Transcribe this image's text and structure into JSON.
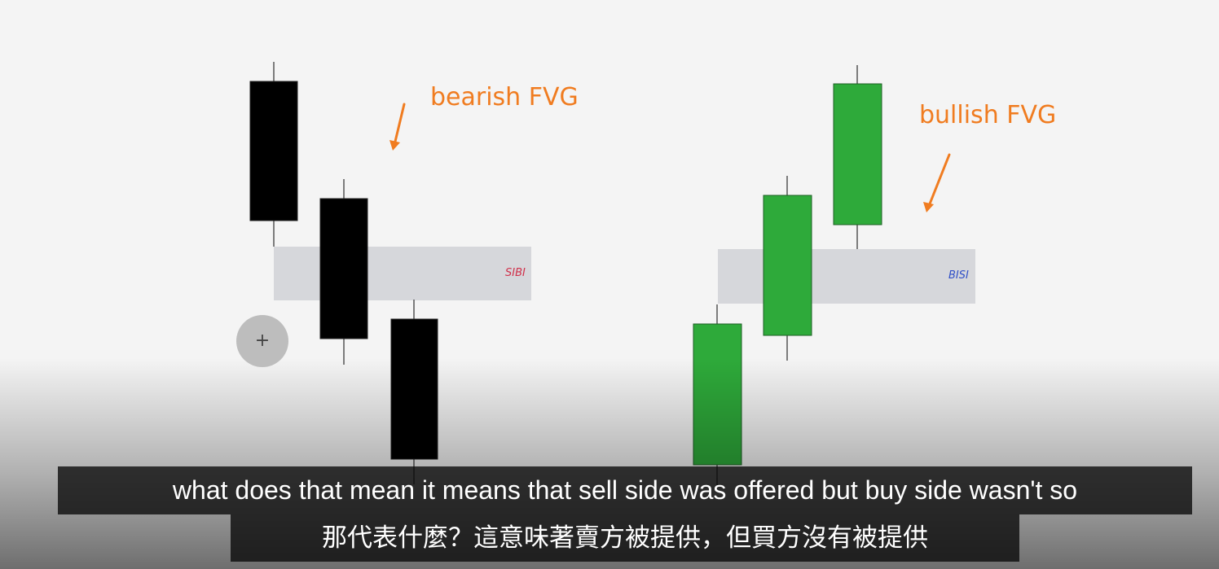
{
  "annotations": {
    "bearish": "bearish FVG",
    "bullish": "bullish FVG"
  },
  "zones": {
    "sibi": "SIBI",
    "bisi": "BISI"
  },
  "zoom_button": {
    "icon": "plus-icon",
    "symbol": "+"
  },
  "captions": {
    "english": "what does that mean it means that sell side was offered but buy side wasn't so",
    "chinese": "那代表什麼？這意味著賣方被提供，但買方沒有被提供"
  },
  "colors": {
    "bearish_candle": "#000000",
    "bullish_candle": "#2eaa3a",
    "annotation": "#f07c20",
    "zone_fill": "#d6d7db",
    "sibi_label": "#d0304a",
    "bisi_label": "#3050c8"
  }
}
